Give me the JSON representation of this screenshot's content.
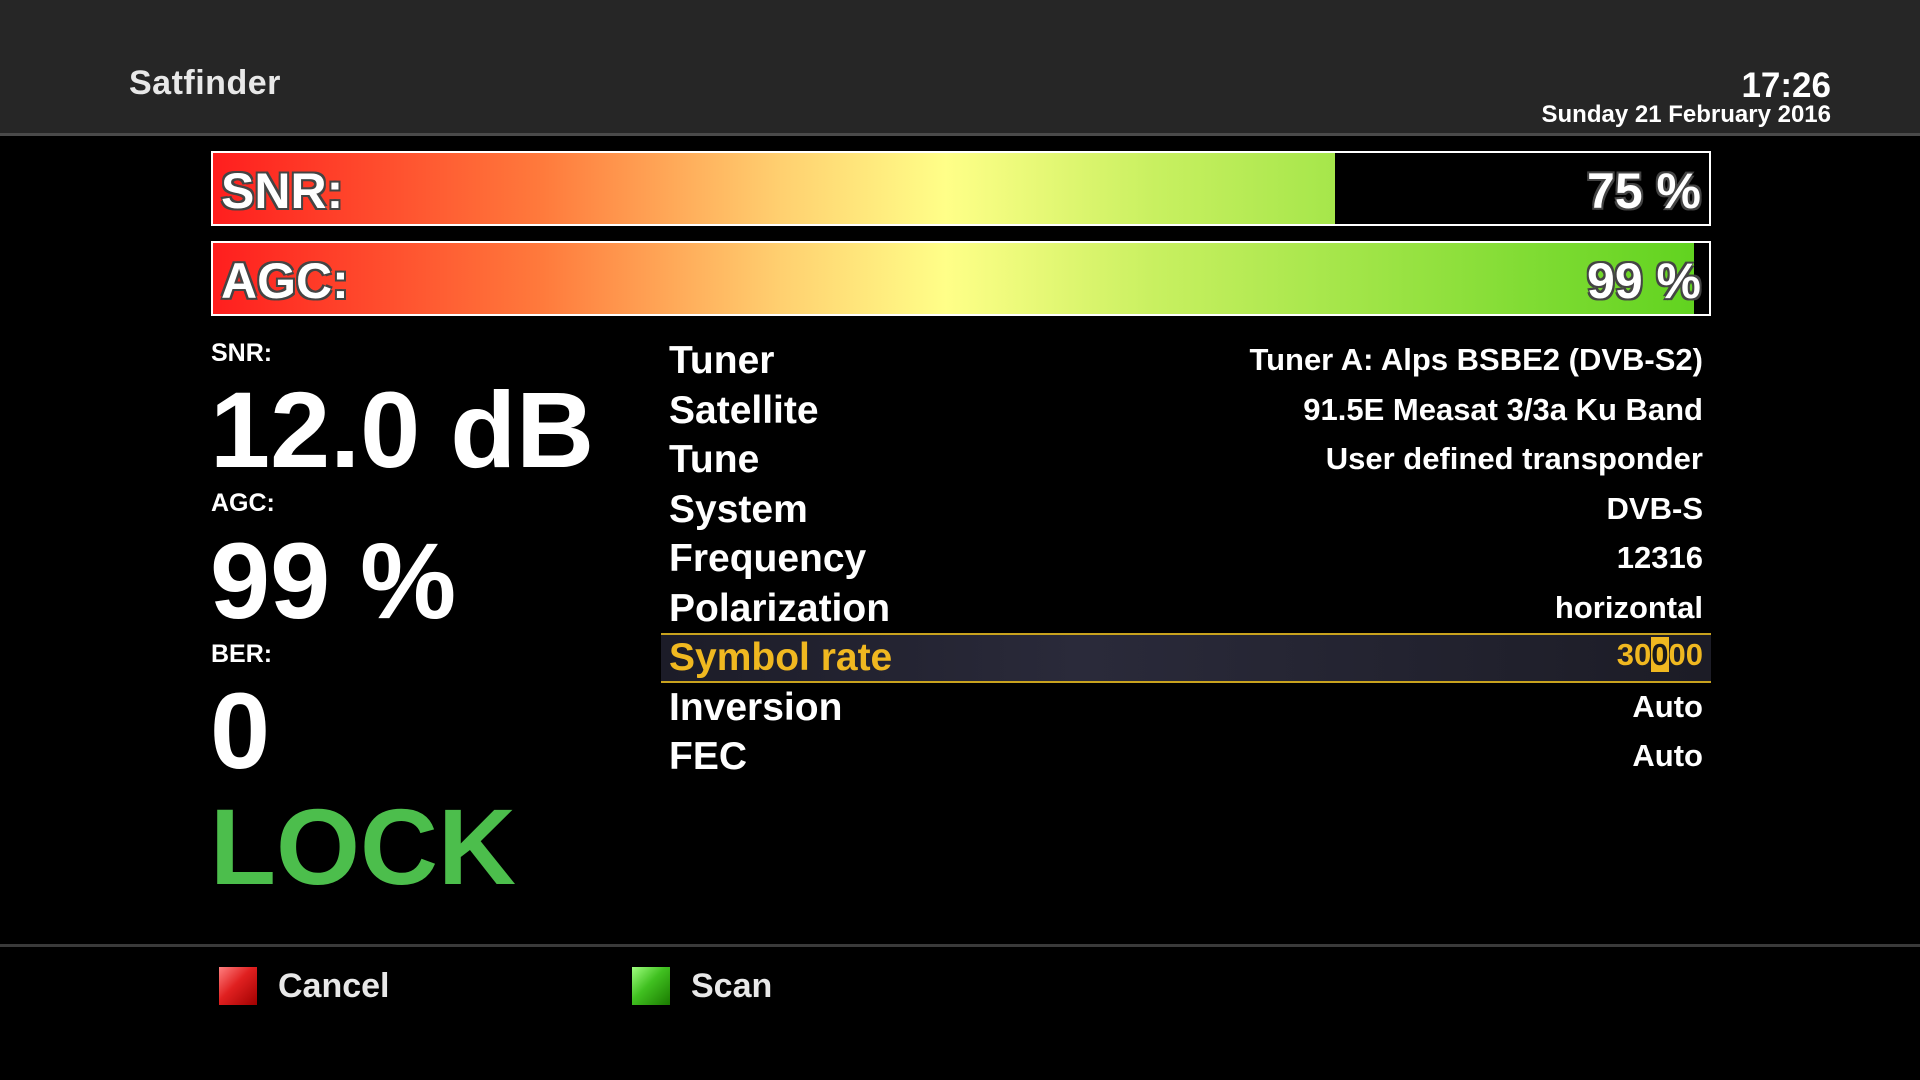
{
  "header": {
    "title": "Satfinder",
    "time": "17:26",
    "date": "Sunday 21 February 2016"
  },
  "bars": {
    "snr": {
      "label": "SNR:",
      "value": "75 %",
      "level_percent": 75
    },
    "agc": {
      "label": "AGC:",
      "value": "99 %",
      "level_percent": 99
    }
  },
  "stats": {
    "snr_label": "SNR:",
    "snr_value": "12.0 dB",
    "agc_label": "AGC:",
    "agc_value": "99 %",
    "ber_label": "BER:",
    "ber_value": "0",
    "lock_status": "LOCK"
  },
  "params": [
    {
      "name": "Tuner",
      "value": "Tuner A: Alps BSBE2 (DVB-S2)"
    },
    {
      "name": "Satellite",
      "value": "91.5E Measat 3/3a Ku Band"
    },
    {
      "name": "Tune",
      "value": "User defined transponder"
    },
    {
      "name": "System",
      "value": "DVB-S"
    },
    {
      "name": "Frequency",
      "value": "12316"
    },
    {
      "name": "Polarization",
      "value": "horizontal"
    },
    {
      "name": "Symbol rate",
      "value_before_cursor": "30",
      "value_cursor": "0",
      "value_after_cursor": "00"
    },
    {
      "name": "Inversion",
      "value": "Auto"
    },
    {
      "name": "FEC",
      "value": "Auto"
    }
  ],
  "selected_param_index": 6,
  "footer": {
    "red_label": "Cancel",
    "green_label": "Scan"
  },
  "colors": {
    "background": "#000000",
    "header_bg": "#262626",
    "selection_accent": "#f0b820",
    "lock_green": "#4cbe4c",
    "red_key": "#e02020",
    "green_key": "#40c020"
  }
}
